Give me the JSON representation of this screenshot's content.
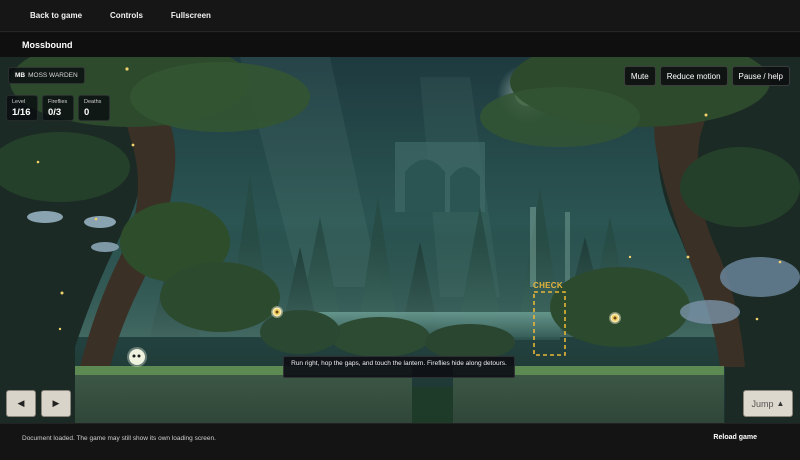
{
  "topbar": {
    "back_label": "Back to game",
    "controls_label": "Controls",
    "fullscreen_label": "Fullscreen"
  },
  "game_title": "Mossbound",
  "hud": {
    "brand_badge": "MB",
    "brand_name": "MOSS WARDEN",
    "level_label": "Level",
    "level_value": "1/16",
    "fireflies_label": "Fireflies",
    "fireflies_value": "0/3",
    "deaths_label": "Deaths",
    "deaths_value": "0",
    "mute_label": "Mute",
    "reduce_motion_label": "Reduce motion",
    "pause_label": "Pause / help",
    "checkpoint_label": "CHECK",
    "hint_text": "Run right, hop the gaps, and touch the lantern. Fireflies hide along detours.",
    "left_icon": "arrow-left",
    "right_icon": "arrow-right",
    "left_glyph": "◀",
    "right_glyph": "▶",
    "jump_label": "Jump",
    "jump_glyph": "▲"
  },
  "status": {
    "message": "Document loaded. The game may still show its own loading screen.",
    "reload_label": "Reload game"
  },
  "colors": {
    "accent_gold": "#e6b53a",
    "ground_top": "#4a6a3a",
    "ground_body": "#3b5344"
  }
}
